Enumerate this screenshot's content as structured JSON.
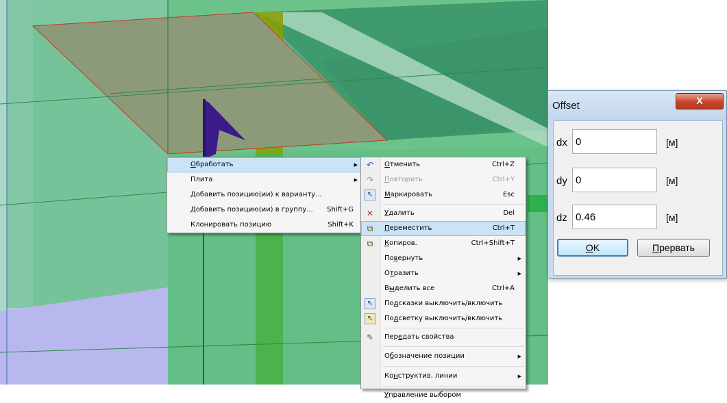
{
  "viewport": {
    "colors": {
      "background_green": "#6cc38a",
      "dark_green": "#3f9a6d",
      "light_band": "#b3dcc4",
      "plate_fill": "#8c9a79",
      "column_olive": "#8aa000",
      "flag_navy": "#3b1a8a",
      "lilac": "#b9b8ee"
    }
  },
  "menu1": {
    "items": [
      {
        "label": "Обработать",
        "underline": "О",
        "rest": "бработать",
        "submenu": true,
        "highlighted": true
      },
      {
        "label": "Плита",
        "underline": "",
        "rest": "Плита",
        "submenu": true
      },
      {
        "label": "Добавить позицию(ии) к варианту...",
        "underline": "",
        "rest": "Добавить позицию(ии) к варианту..."
      },
      {
        "label": "Добавить позицию(ии) в группу...",
        "underline": "",
        "rest": "Добавить позицию(ии) в группу...",
        "shortcut": "Shift+G"
      },
      {
        "label": "Клонировать позицию",
        "underline": "",
        "rest": "Клонировать позицию",
        "shortcut": "Shift+K"
      }
    ]
  },
  "menu2": {
    "items": [
      {
        "u": "О",
        "rest": "тменить",
        "shortcut": "Ctrl+Z",
        "icon": "undo-icon",
        "glyph": "↶"
      },
      {
        "u": "П",
        "rest": "овторить",
        "shortcut": "Ctrl+Y",
        "icon": "redo-icon",
        "glyph": "↷",
        "disabled": true
      },
      {
        "u": "М",
        "rest": "аркировать",
        "shortcut": "Esc",
        "icon": "select-cursor-icon",
        "glyph": "⇖"
      },
      {
        "u": "У",
        "rest": "далить",
        "shortcut": "Del",
        "icon": "delete-icon",
        "glyph": "✕"
      },
      {
        "u": "П",
        "rest": "ереместить",
        "shortcut": "Ctrl+T",
        "icon": "move-icon",
        "glyph": "⧉",
        "highlighted": true
      },
      {
        "u": "К",
        "rest": "опиров.",
        "shortcut": "Ctrl+Shift+T",
        "icon": "copy-icon",
        "glyph": "⧉"
      },
      {
        "pre": "По",
        "u": "в",
        "rest": "ернуть",
        "submenu": true
      },
      {
        "pre": "О",
        "u": "т",
        "rest": "разить",
        "submenu": true
      },
      {
        "pre": "В",
        "u": "ы",
        "rest": "делить все",
        "shortcut": "Ctrl+A"
      },
      {
        "pre": "По",
        "u": "д",
        "rest": "сказки выключить/включить",
        "icon": "tooltip-toggle-icon",
        "glyph": "⇖"
      },
      {
        "pre": "По",
        "u": "д",
        "rest": "светку выключить/включить",
        "icon": "highlight-toggle-icon",
        "glyph": "⇖"
      },
      {
        "pre": "Пер",
        "u": "е",
        "rest": "дать свойства",
        "icon": "transfer-properties-icon",
        "glyph": "✎"
      },
      {
        "pre": "О",
        "u": "б",
        "rest": "означение позиции",
        "submenu": true
      },
      {
        "pre": "Ко",
        "u": "н",
        "rest": "структив. линии",
        "submenu": true
      },
      {
        "pre": "",
        "u": "У",
        "rest": "правление выбором"
      }
    ]
  },
  "dialog": {
    "title": "Offset",
    "close_glyph": "X",
    "fields": [
      {
        "label": "dx",
        "value": "0",
        "unit": "[м]"
      },
      {
        "label": "dy",
        "value": "0",
        "unit": "[м]"
      },
      {
        "label": "dz",
        "value": "0.46",
        "unit": "[м]"
      }
    ],
    "ok_u": "O",
    "ok_rest": "K",
    "cancel_u": "П",
    "cancel_rest": "рервать"
  }
}
